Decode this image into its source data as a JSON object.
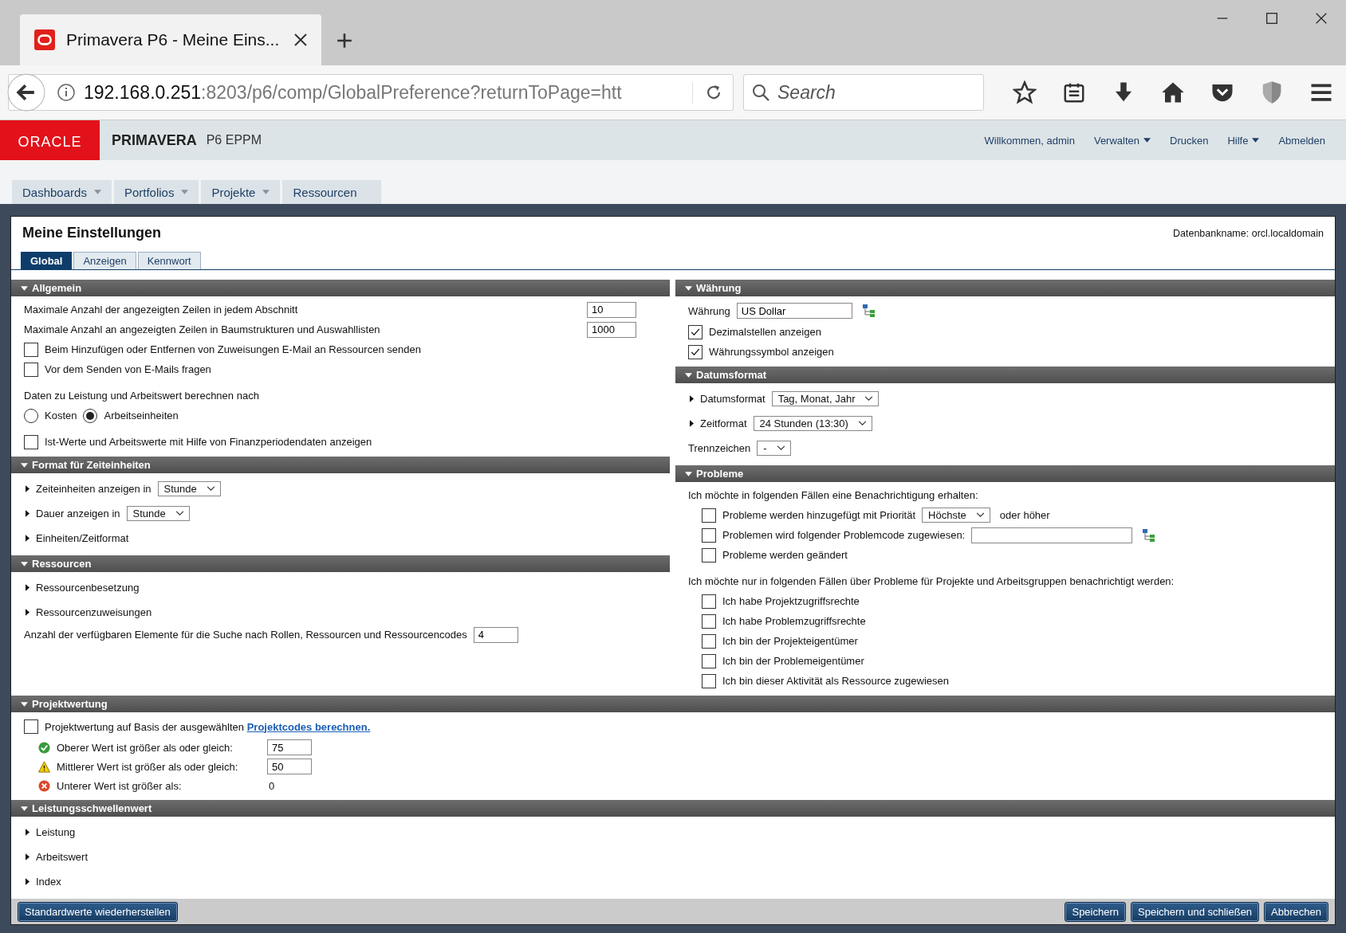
{
  "browser": {
    "tab_title": "Primavera P6 - Meine Eins...",
    "url_host": "192.168.0.251",
    "url_path": ":8203/p6/comp/GlobalPreference?returnToPage=htt",
    "search_placeholder": "Search"
  },
  "header": {
    "logo": "ORACLE",
    "product": "PRIMAVERA",
    "edition": "P6 EPPM",
    "links": [
      {
        "label": "Willkommen, admin",
        "dropdown": false
      },
      {
        "label": "Verwalten",
        "dropdown": true
      },
      {
        "label": "Drucken",
        "dropdown": false
      },
      {
        "label": "Hilfe",
        "dropdown": true
      },
      {
        "label": "Abmelden",
        "dropdown": false
      }
    ]
  },
  "nav_tabs": [
    {
      "label": "Dashboards",
      "dropdown": true
    },
    {
      "label": "Portfolios",
      "dropdown": true
    },
    {
      "label": "Projekte",
      "dropdown": true
    },
    {
      "label": "Ressourcen",
      "dropdown": false
    }
  ],
  "page": {
    "title": "Meine Einstellungen",
    "database": "Datenbankname: orcl.localdomain",
    "tabs": [
      {
        "label": "Global",
        "selected": true
      },
      {
        "label": "Anzeigen",
        "selected": false
      },
      {
        "label": "Kennwort",
        "selected": false
      }
    ]
  },
  "columns": [
    [
      {
        "title": "Allgemein",
        "rows": [
          {
            "kind": "field_right",
            "label": "Maximale Anzahl der angezeigten Zeilen in jedem Abschnitt",
            "value": "10"
          },
          {
            "kind": "field_right",
            "label": "Maximale Anzahl an angezeigten Zeilen in Baumstrukturen und Auswahllisten",
            "value": "1000"
          },
          {
            "kind": "checkbox",
            "label": "Beim Hinzufügen oder Entfernen von Zuweisungen E-Mail an Ressourcen senden",
            "checked": false
          },
          {
            "kind": "checkbox",
            "label": "Vor dem Senden von E-Mails fragen",
            "checked": false
          },
          {
            "kind": "note",
            "text": "Daten zu Leistung und Arbeitswert berechnen nach"
          },
          {
            "kind": "radio",
            "options": [
              {
                "label": "Kosten",
                "selected": false
              },
              {
                "label": "Arbeitseinheiten",
                "selected": true
              }
            ]
          },
          {
            "kind": "checkbox",
            "label": "Ist-Werte und Arbeitswerte mit Hilfe von Finanzperiodendaten anzeigen",
            "checked": false
          }
        ]
      },
      {
        "title": "Format für Zeiteinheiten",
        "rows": [
          {
            "kind": "expander",
            "label": "Zeiteinheiten anzeigen in",
            "select": "Stunde"
          },
          {
            "kind": "expander",
            "label": "Dauer anzeigen in",
            "select": "Stunde"
          },
          {
            "kind": "expander",
            "label": "Einheiten/Zeitformat"
          }
        ]
      },
      {
        "title": "Ressourcen",
        "rows": [
          {
            "kind": "expander",
            "label": "Ressourcenbesetzung"
          },
          {
            "kind": "expander",
            "label": "Ressourcenzuweisungen"
          },
          {
            "kind": "field",
            "label": "Anzahl der verfügbaren Elemente für die Suche nach Rollen, Ressourcen und Ressourcencodes",
            "value": "4"
          }
        ]
      }
    ],
    [
      {
        "title": "Währung",
        "rows": [
          {
            "kind": "field_tree",
            "label": "Währung",
            "value": "US Dollar"
          },
          {
            "kind": "checkbox",
            "label": "Dezimalstellen anzeigen",
            "checked": true
          },
          {
            "kind": "checkbox",
            "label": "Währungssymbol anzeigen",
            "checked": true
          }
        ]
      },
      {
        "title": "Datumsformat",
        "rows": [
          {
            "kind": "expander",
            "label": "Datumsformat",
            "select": "Tag, Monat, Jahr"
          },
          {
            "kind": "expander",
            "label": "Zeitformat",
            "select": "24 Stunden (13:30)"
          },
          {
            "kind": "select",
            "label": "Trennzeichen",
            "select": "-"
          }
        ]
      },
      {
        "title": "Probleme",
        "rows": [
          {
            "kind": "note",
            "text": "Ich möchte in folgenden Fällen eine Benachrichtigung erhalten:",
            "children": [
              {
                "kind": "checkbox",
                "label": "Probleme werden hinzugefügt mit Priorität",
                "checked": false,
                "select": "Höchste",
                "suffix": "oder höher"
              },
              {
                "kind": "checkbox_code",
                "label": "Problemen wird folgender Problemcode zugewiesen:",
                "checked": false
              },
              {
                "kind": "checkbox",
                "label": "Probleme werden geändert",
                "checked": false
              }
            ]
          },
          {
            "kind": "note",
            "text": "Ich möchte nur in folgenden Fällen über Probleme für Projekte und Arbeitsgruppen benachrichtigt werden:",
            "children": [
              {
                "kind": "checkbox",
                "label": "Ich habe Projektzugriffsrechte",
                "checked": false
              },
              {
                "kind": "checkbox",
                "label": "Ich habe Problemzugriffsrechte",
                "checked": false
              },
              {
                "kind": "checkbox",
                "label": "Ich bin der Projekteigentümer",
                "checked": false
              },
              {
                "kind": "checkbox",
                "label": "Ich bin der Problemeigentümer",
                "checked": false
              },
              {
                "kind": "checkbox",
                "label": "Ich bin dieser Aktivität als Ressource zugewiesen",
                "checked": false
              }
            ]
          }
        ]
      }
    ]
  ],
  "full_sections": [
    {
      "title": "Projektwertung",
      "rows": [
        {
          "kind": "checkbox_link",
          "label": "Projektwertung auf Basis der ausgewählten",
          "link": "Projektcodes berechnen.",
          "checked": false
        },
        {
          "kind": "good",
          "label": "Oberer Wert ist größer als oder gleich:",
          "value": "75",
          "editable": true
        },
        {
          "kind": "warning",
          "label": "Mittlerer Wert ist größer als oder gleich:",
          "value": "50",
          "editable": true
        },
        {
          "kind": "error",
          "label": "Unterer Wert ist größer als:",
          "value": "0",
          "editable": false
        }
      ]
    },
    {
      "title": "Leistungsschwellenwert",
      "rows": [
        {
          "kind": "expander",
          "label": "Leistung"
        },
        {
          "kind": "expander",
          "label": "Arbeitswert"
        },
        {
          "kind": "expander",
          "label": "Index"
        }
      ]
    }
  ],
  "footer": {
    "left_buttons": [
      "Standardwerte wiederherstellen"
    ],
    "right_buttons": [
      "Speichern",
      "Speichern und schließen",
      "Abbrechen"
    ]
  }
}
